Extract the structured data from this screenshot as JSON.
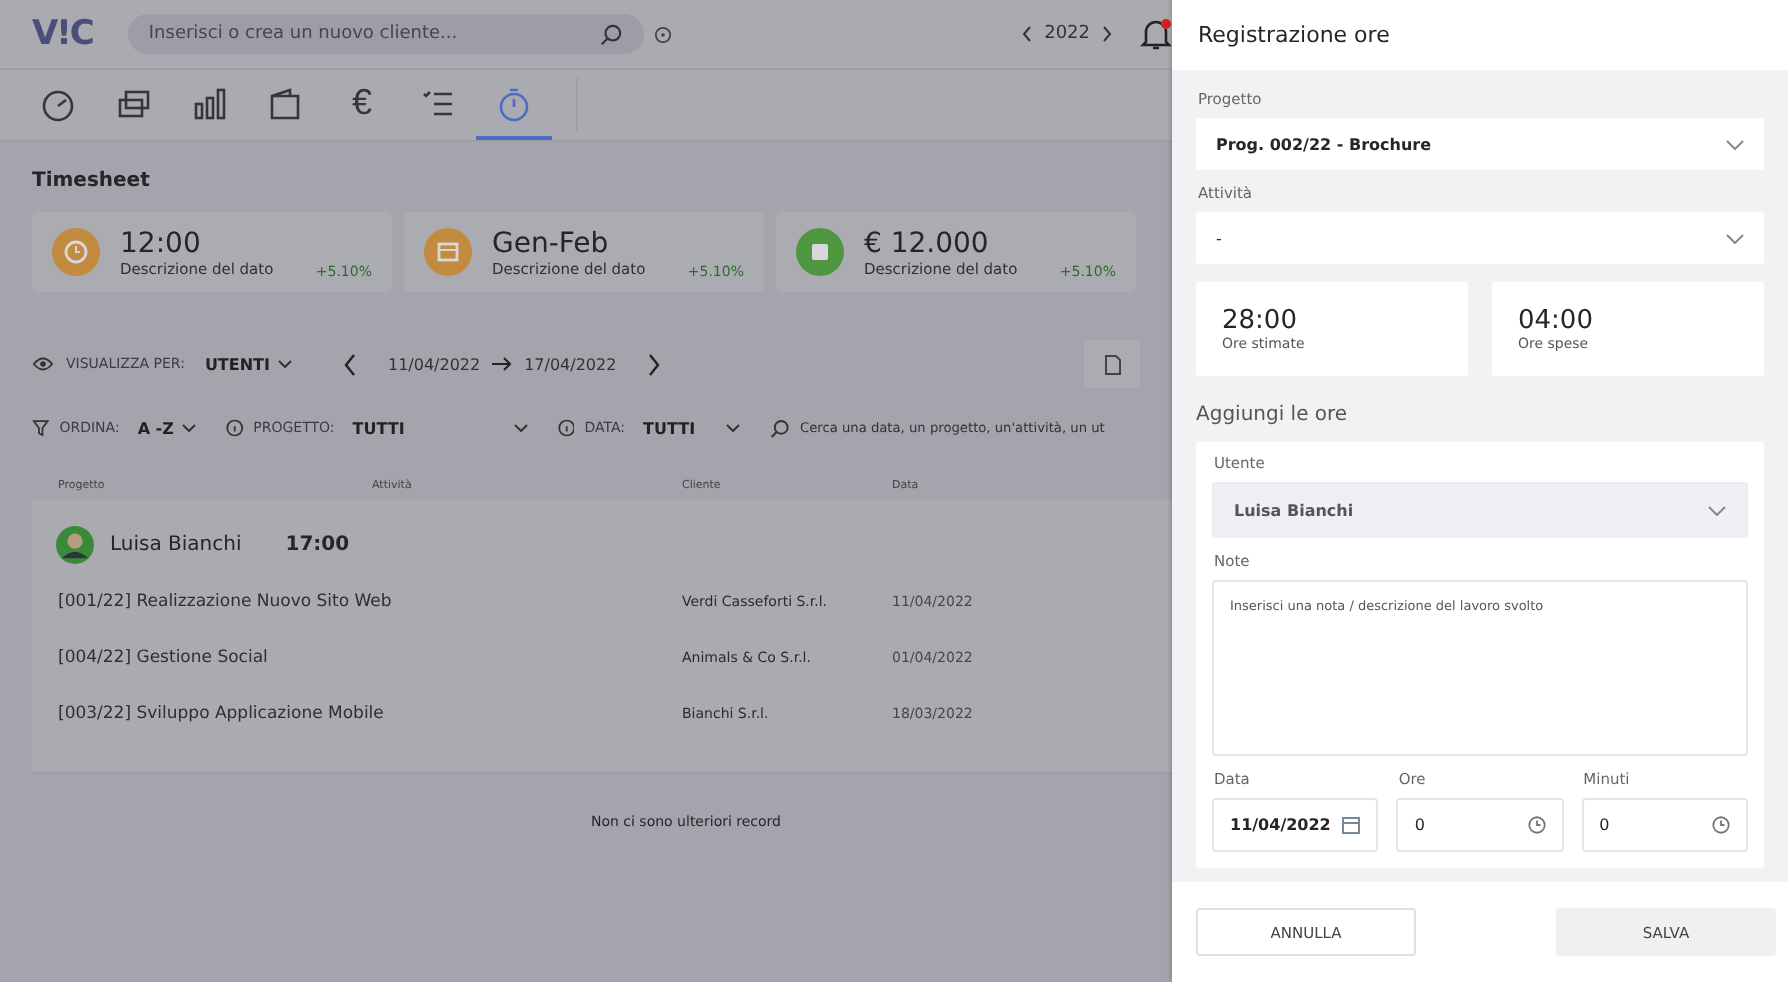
{
  "topbar": {
    "logo": "V!C",
    "search": {
      "placeholder": "Inserisci o crea un nuovo cliente..."
    },
    "year": "2022",
    "notifications": true
  },
  "nav": [
    {
      "selected": false
    },
    {
      "selected": false
    },
    {
      "selected": false
    },
    {
      "selected": false
    },
    {
      "label": "€",
      "selected": false
    },
    {
      "selected": false
    },
    {
      "selected": true
    }
  ],
  "page_title": "Timesheet",
  "stats": [
    {
      "color": "#c38b3d",
      "value": "12:00",
      "description": "Descrizione del dato",
      "delta": "+5.10%"
    },
    {
      "color": "#c38b3d",
      "value": "Gen-Feb",
      "description": "Descrizione del dato",
      "delta": "+5.10%"
    },
    {
      "color": "#4f9640",
      "value": "€ 12.000",
      "description": "Descrizione del dato",
      "delta": "+5.10%"
    }
  ],
  "view": {
    "label": "VISUALIZZA PER:",
    "value": "UTENTI",
    "date_from": "11/04/2022",
    "date_to": "17/04/2022"
  },
  "filters": [
    {
      "label": "ORDINA:",
      "value": "A -Z"
    },
    {
      "label": "PROGETTO:",
      "value": "TUTTI"
    },
    {
      "label": "DATA:",
      "value": "TUTTI"
    }
  ],
  "table_search": {
    "placeholder": "Cerca una data, un progetto, un'attività, un ut"
  },
  "table": {
    "columns": [
      "Progetto",
      "Attività",
      "Cliente",
      "Data"
    ],
    "group": {
      "user": "Luisa Bianchi",
      "total": "17:00"
    },
    "rows": [
      {
        "project": "[001/22] Realizzazione Nuovo Sito Web",
        "client": "Verdi Casseforti S.r.l.",
        "date": "11/04/2022"
      },
      {
        "project": "[004/22] Gestione Social",
        "client": "Animals & Co S.r.l.",
        "date": "01/04/2022"
      },
      {
        "project": "[003/22] Sviluppo Applicazione Mobile",
        "client": "Bianchi S.r.l.",
        "date": "18/03/2022"
      }
    ],
    "footer": "Non ci sono ulteriori record"
  },
  "panel": {
    "title": "Registrazione ore",
    "project": {
      "label": "Progetto",
      "value": "Prog. 002/22 - Brochure"
    },
    "activity": {
      "label": "Attività",
      "value": "-"
    },
    "summary": [
      {
        "value": "28:00",
        "label": "Ore stimate"
      },
      {
        "value": "04:00",
        "label": "Ore spese"
      }
    ],
    "section_title": "Aggiungi le ore",
    "user": {
      "label": "Utente",
      "value": "Luisa Bianchi",
      "disabled": true
    },
    "note": {
      "label": "Note",
      "placeholder": "Inserisci una nota / descrizione del lavoro svolto"
    },
    "date": {
      "label": "Data",
      "value": "11/04/2022"
    },
    "hours": {
      "label": "Ore",
      "value": "0"
    },
    "minutes": {
      "label": "Minuti",
      "value": "0"
    },
    "buttons": [
      {
        "label": "ANNULLA",
        "kind": "secondary"
      },
      {
        "label": "SALVA",
        "kind": "primary"
      }
    ]
  }
}
